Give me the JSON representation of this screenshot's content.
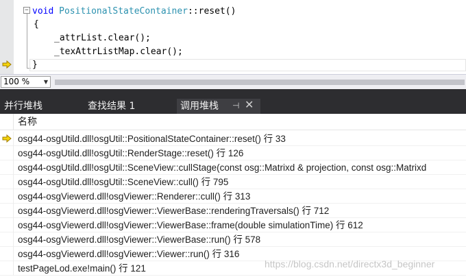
{
  "editor": {
    "fold_glyph": "−",
    "lines": {
      "l1_kw": "void",
      "l1_type": "PositionalStateContainer",
      "l1_rest": "::reset()",
      "l2": "{",
      "l3": "_attrList.clear();",
      "l4": "_texAttrListMap.clear();",
      "l5": "}"
    },
    "current_line_marker": "execution-pointer-arrow"
  },
  "zoom": {
    "value": "100 %",
    "dropdown_glyph": "▼"
  },
  "tabs": [
    {
      "label": "并行堆栈",
      "active": false
    },
    {
      "label": "查找结果 1",
      "active": false
    },
    {
      "label": "调用堆栈",
      "active": true
    }
  ],
  "tab_actions": {
    "pin_glyph": "⊣",
    "close_glyph": "✕"
  },
  "callstack": {
    "column_header": "名称",
    "frames": [
      "osg44-osgUtild.dll!osgUtil::PositionalStateContainer::reset() 行 33",
      "osg44-osgUtild.dll!osgUtil::RenderStage::reset() 行 126",
      "osg44-osgUtild.dll!osgUtil::SceneView::cullStage(const osg::Matrixd & projection, const osg::Matrixd",
      "osg44-osgUtild.dll!osgUtil::SceneView::cull() 行 795",
      "osg44-osgViewerd.dll!osgViewer::Renderer::cull() 行 313",
      "osg44-osgViewerd.dll!osgViewer::ViewerBase::renderingTraversals() 行 712",
      "osg44-osgViewerd.dll!osgViewer::ViewerBase::frame(double simulationTime) 行 612",
      "osg44-osgViewerd.dll!osgViewer::ViewerBase::run() 行 578",
      "osg44-osgViewerd.dll!osgViewer::Viewer::run() 行 316",
      "testPageLod.exe!main() 行 121"
    ]
  },
  "watermark": "https://blog.csdn.net/directx3d_beginner",
  "colors": {
    "arrow_fill": "#f5d40b",
    "arrow_stroke": "#a07c00",
    "tab_background": "#2d2d30",
    "keyword": "#0000ff",
    "type": "#2b91af"
  }
}
